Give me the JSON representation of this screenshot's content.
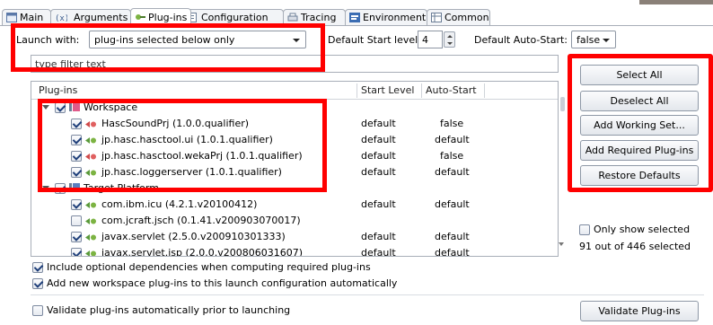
{
  "tabs": [
    {
      "label": "Main",
      "icon": "main-tab-icon",
      "active": false
    },
    {
      "label": "Arguments",
      "icon": "arguments-tab-icon",
      "active": false
    },
    {
      "label": "Plug-ins",
      "icon": "plugins-tab-icon",
      "active": true
    },
    {
      "label": "Configuration",
      "icon": "configuration-tab-icon",
      "active": false
    },
    {
      "label": "Tracing",
      "icon": "tracing-tab-icon",
      "active": false
    },
    {
      "label": "Environment",
      "icon": "environment-tab-icon",
      "active": false
    },
    {
      "label": "Common",
      "icon": "common-tab-icon",
      "active": false
    }
  ],
  "launch": {
    "label": "Launch with:",
    "selected": "plug-ins selected below only",
    "default_start_label": "Default Start level:",
    "default_start_value": "4",
    "auto_start_label": "Default Auto-Start:",
    "auto_start_value": "false"
  },
  "filter": {
    "placeholder": "type filter text"
  },
  "table": {
    "headers": {
      "plugins": "Plug-ins",
      "start_level": "Start Level",
      "auto_start": "Auto-Start"
    },
    "rows": [
      {
        "kind": "group",
        "label": "Workspace",
        "start": "",
        "auto": "",
        "checked": true
      },
      {
        "kind": "item",
        "label": "HascSoundPrj (1.0.0.qualifier)",
        "start": "default",
        "auto": "false",
        "checked": true,
        "icon": "plugin-red-icon"
      },
      {
        "kind": "item",
        "label": "jp.hasc.hasctool.ui (1.0.1.qualifier)",
        "start": "default",
        "auto": "default",
        "checked": true,
        "icon": "plugin-green-icon"
      },
      {
        "kind": "item",
        "label": "jp.hasc.hasctool.wekaPrj (1.0.1.qualifier)",
        "start": "default",
        "auto": "false",
        "checked": true,
        "icon": "plugin-red-icon"
      },
      {
        "kind": "item",
        "label": "jp.hasc.loggerserver (1.0.1.qualifier)",
        "start": "default",
        "auto": "default",
        "checked": true,
        "icon": "plugin-green-icon"
      },
      {
        "kind": "group",
        "label": "Target Platform",
        "start": "",
        "auto": "",
        "checked": true
      },
      {
        "kind": "item",
        "label": "com.ibm.icu (4.2.1.v20100412)",
        "start": "default",
        "auto": "default",
        "checked": true,
        "icon": "plugin-green-icon"
      },
      {
        "kind": "item",
        "label": "com.jcraft.jsch (0.1.41.v200903070017)",
        "start": "",
        "auto": "",
        "checked": false,
        "icon": "plugin-green-icon"
      },
      {
        "kind": "item",
        "label": "javax.servlet (2.5.0.v200910301333)",
        "start": "default",
        "auto": "default",
        "checked": true,
        "icon": "plugin-green-icon"
      },
      {
        "kind": "item",
        "label": "javax.servlet.jsp (2.0.0.v200806031607)",
        "start": "default",
        "auto": "default",
        "checked": true,
        "icon": "plugin-green-icon"
      }
    ]
  },
  "buttons": {
    "select_all": "Select All",
    "deselect_all": "Deselect All",
    "add_working_set": "Add Working Set...",
    "add_required": "Add Required Plug-ins",
    "restore_defaults": "Restore Defaults",
    "validate": "Validate Plug-ins"
  },
  "side": {
    "only_show_selected": "Only show selected",
    "only_show_selected_checked": false,
    "count_text": "91 out of 446 selected"
  },
  "options": {
    "include_optional": "Include optional dependencies when computing required plug-ins",
    "include_optional_checked": true,
    "add_new_workspace": "Add new workspace plug-ins to this launch configuration automatically",
    "add_new_workspace_checked": true,
    "validate_auto": "Validate plug-ins automatically prior to launching",
    "validate_auto_checked": false
  },
  "colors": {
    "highlight": "#ff0000",
    "accent_blue": "#1f3f7a"
  }
}
